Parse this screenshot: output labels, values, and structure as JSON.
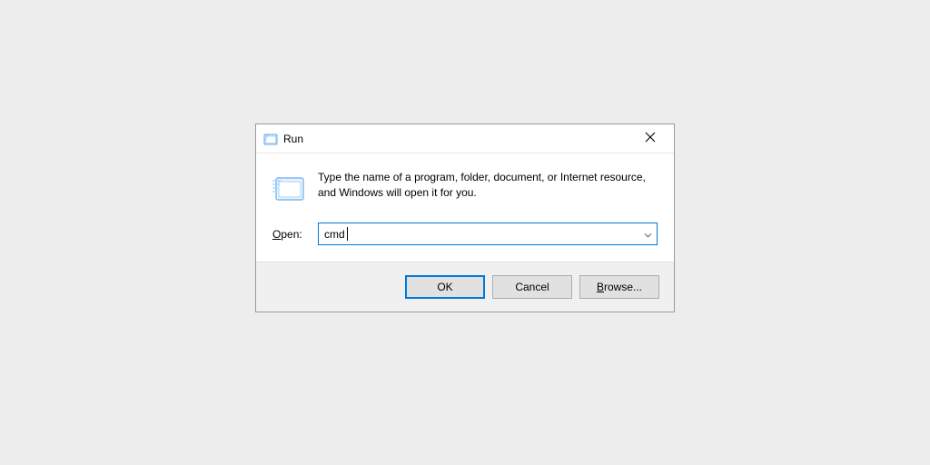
{
  "title": "Run",
  "description": "Type the name of a program, folder, document, or Internet resource, and Windows will open it for you.",
  "open_label_prefix": "O",
  "open_label_rest": "pen:",
  "input_value": "cmd",
  "buttons": {
    "ok": "OK",
    "cancel": "Cancel",
    "browse_prefix": "B",
    "browse_rest": "rowse..."
  }
}
